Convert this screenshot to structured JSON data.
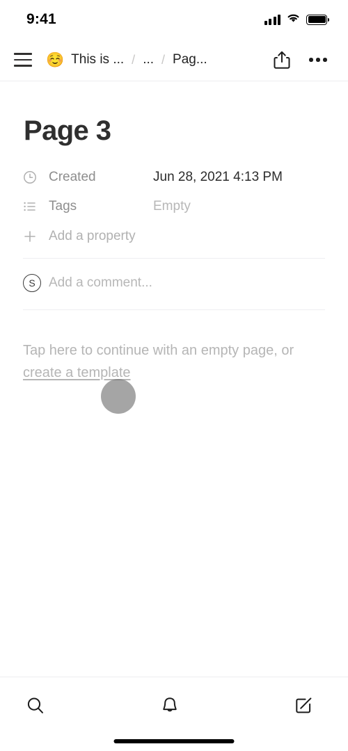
{
  "status_bar": {
    "time": "9:41",
    "signal_icon": "cellular-signal-icon",
    "wifi_icon": "wifi-icon",
    "battery_icon": "battery-full-icon"
  },
  "header": {
    "menu_icon": "hamburger-menu-icon",
    "breadcrumb": {
      "emoji": "☺️",
      "items": [
        {
          "label": "This is ..."
        },
        {
          "label": "..."
        },
        {
          "label": "Pag..."
        }
      ],
      "separator": "/"
    },
    "share_icon": "share-icon",
    "more_icon": "more-options-icon"
  },
  "page": {
    "title": "Page 3",
    "properties": [
      {
        "icon": "clock-icon",
        "label": "Created",
        "value": "Jun 28, 2021 4:13 PM",
        "is_empty": false
      },
      {
        "icon": "list-icon",
        "label": "Tags",
        "value": "Empty",
        "is_empty": true
      }
    ],
    "add_property": {
      "icon": "plus-icon",
      "label": "Add a property"
    },
    "comment": {
      "avatar_initial": "S",
      "placeholder": "Add a comment..."
    },
    "empty_hint": {
      "text": "Tap here to continue with an empty page, or ",
      "link_text": "create a template"
    }
  },
  "tab_bar": {
    "items": [
      {
        "icon": "search-icon",
        "name": "search"
      },
      {
        "icon": "bell-icon",
        "name": "notifications"
      },
      {
        "icon": "compose-icon",
        "name": "new-page"
      }
    ]
  },
  "colors": {
    "text_primary": "#2f2f2f",
    "text_secondary": "#8e8e8e",
    "text_placeholder": "#b7b7b7",
    "divider": "#eeeef1",
    "emoji_yellow": "#f7ca52"
  }
}
